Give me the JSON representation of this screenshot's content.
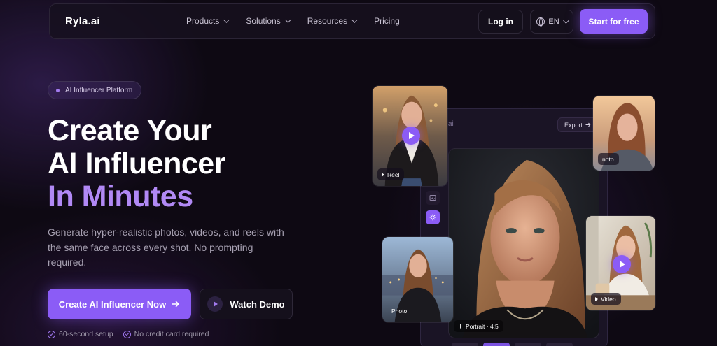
{
  "nav": {
    "logo": "Ryla.ai",
    "links": [
      {
        "label": "Products",
        "has_dropdown": true
      },
      {
        "label": "Solutions",
        "has_dropdown": true
      },
      {
        "label": "Resources",
        "has_dropdown": true
      },
      {
        "label": "Pricing",
        "has_dropdown": false
      }
    ],
    "login_label": "Log in",
    "language_label": "EN",
    "start_label": "Start for free"
  },
  "hero": {
    "badge": "AI Influencer Platform",
    "headline_line1": "Create Your",
    "headline_line2": "AI Influencer",
    "headline_line3": "In Minutes",
    "subtext": "Generate hyper-realistic photos, videos, and reels with the same face across every shot. No prompting required.",
    "cta_primary": "Create AI Influencer Now",
    "cta_secondary": "Watch Demo",
    "checks": [
      "60-second setup",
      "No credit card required"
    ]
  },
  "visual": {
    "panel_title": "ai",
    "export_label": "Export",
    "cards": {
      "reel": "Reel",
      "photo_top": "noto",
      "photo_bottom": "Photo",
      "portrait": "Portrait · 4:5",
      "video": "Video"
    }
  },
  "colors": {
    "accent": "#8b5cf6",
    "accent_text": "#b189f5",
    "background": "#0e0913"
  }
}
